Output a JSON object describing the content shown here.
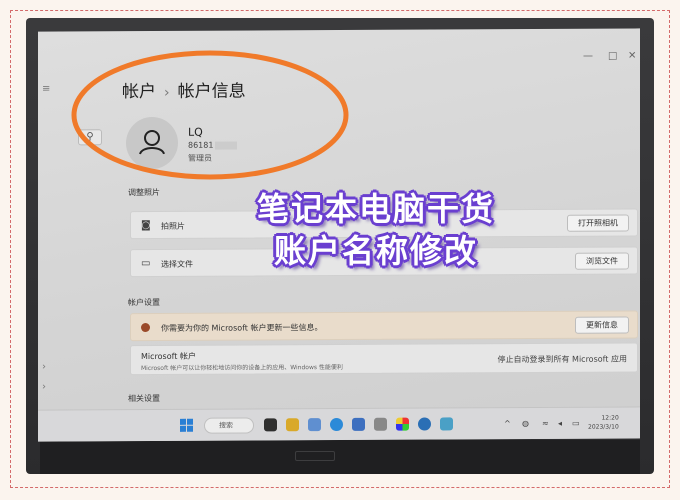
{
  "window": {
    "minimize_glyph": "—",
    "maximize_glyph": "□",
    "close_glyph": "✕"
  },
  "breadcrumb": {
    "parent": "帐户",
    "separator": "›",
    "current": "帐户信息"
  },
  "user": {
    "name": "LQ",
    "id_partial": "86181",
    "role": "管理员"
  },
  "photo_section": {
    "heading": "调整照片",
    "rows": [
      {
        "icon": "camera-icon",
        "label": "拍照片",
        "button": "打开照相机"
      },
      {
        "icon": "folder-icon",
        "label": "选择文件",
        "button": "浏览文件"
      }
    ]
  },
  "account_settings": {
    "heading": "帐户设置",
    "warning_text": "你需要为你的 Microsoft 帐户更新一些信息。",
    "warning_button": "更新信息",
    "ms_title": "Microsoft 帐户",
    "ms_subtitle": "Microsoft 帐户可以让你轻松地访问你的设备上的应用、Windows 性能便利",
    "ms_link": "停止自动登录到所有 Microsoft 应用"
  },
  "related": {
    "heading": "相关设置"
  },
  "taskbar": {
    "search_placeholder": "搜索",
    "time": "12:20",
    "date": "2023/3/10"
  },
  "overlay": {
    "line1": "笔记本电脑干货",
    "line2": "账户名称修改"
  },
  "colors": {
    "highlight_ellipse": "#f07a2a",
    "overlay_text": "#ffffff",
    "overlay_outline": "#6a3fd0",
    "windows_blue": "#2a7fd4"
  }
}
